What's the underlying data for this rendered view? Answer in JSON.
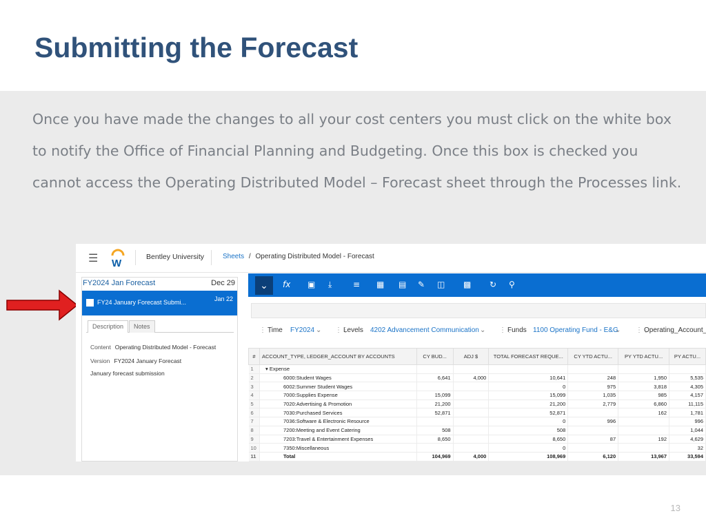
{
  "slide": {
    "title": "Submitting the Forecast",
    "paragraph": "Once you have made the changes to all your cost centers you must click on the white box to notify the Office of Financial Planning and Budgeting.  Once this box is checked you cannot access the Operating Distributed Model – Forecast sheet through the Processes link.",
    "page_number": "13"
  },
  "app": {
    "org_name": "Bentley University",
    "breadcrumb_link": "Sheets",
    "breadcrumb_sep": "/",
    "breadcrumb_current": "Operating Distributed Model - Forecast"
  },
  "left_panel": {
    "header_title": "FY2024 Jan Forecast",
    "header_date": "Dec 29",
    "selected_item_name": "FY24 January Forecast Submi...",
    "selected_item_date": "Jan 22",
    "tabs": [
      "Description",
      "Notes"
    ],
    "content_label": "Content",
    "content_value": "Operating Distributed Model - Forecast",
    "version_label": "Version",
    "version_value": "FY2024 January Forecast",
    "description": "January forecast submission"
  },
  "toolbar": {
    "icons": [
      "chevron-down-icon",
      "fx-icon",
      "save-icon",
      "download-icon",
      "filter-icon",
      "calc-icon",
      "sheet-icon",
      "edit-icon",
      "data-icon",
      "report-icon",
      "refresh-icon",
      "search-icon"
    ]
  },
  "filters": {
    "time_label": "Time",
    "time_value": "FY2024",
    "levels_label": "Levels",
    "levels_value": "4202 Advancement Communication",
    "funds_label": "Funds",
    "funds_value": "1100 Operating Fund - E&G",
    "extra_label": "Operating_Account_F"
  },
  "grid": {
    "headers": [
      "#",
      "ACCOUNT_TYPE, LEDGER_ACCOUNT BY ACCOUNTS",
      "CY BUD...",
      "ADJ $",
      "TOTAL FORECAST REQUE...",
      "CY YTD ACTU...",
      "PY YTD ACTU...",
      "PY ACTU..."
    ],
    "rows": [
      [
        "1",
        "Expense",
        "",
        "",
        "",
        "",
        "",
        ""
      ],
      [
        "2",
        "6000:Student Wages",
        "6,641",
        "4,000",
        "10,641",
        "248",
        "1,950",
        "5,535"
      ],
      [
        "3",
        "6002:Summer Student Wages",
        "",
        "",
        "0",
        "975",
        "3,818",
        "4,305"
      ],
      [
        "4",
        "7000:Supplies Expense",
        "15,099",
        "",
        "15,099",
        "1,035",
        "985",
        "4,157"
      ],
      [
        "5",
        "7020:Advertising & Promotion",
        "21,200",
        "",
        "21,200",
        "2,779",
        "6,860",
        "11,115"
      ],
      [
        "6",
        "7030:Purchased Services",
        "52,871",
        "",
        "52,871",
        "",
        "162",
        "1,781"
      ],
      [
        "7",
        "7036:Software & Electronic Resource",
        "",
        "",
        "0",
        "996",
        "",
        "996"
      ],
      [
        "8",
        "7200:Meeting and Event Catering",
        "508",
        "",
        "508",
        "",
        "",
        "1,044"
      ],
      [
        "9",
        "7203:Travel & Entertainment Expenses",
        "8,650",
        "",
        "8,650",
        "87",
        "192",
        "4,629"
      ],
      [
        "10",
        "7350:Miscellaneous",
        "",
        "",
        "0",
        "",
        "",
        "32"
      ],
      [
        "11",
        "Total",
        "104,969",
        "4,000",
        "108,969",
        "6,120",
        "13,967",
        "33,594"
      ]
    ]
  },
  "colors": {
    "title": "#30527a",
    "accent_blue": "#0a6ed1",
    "arrow_red": "#e02020"
  }
}
